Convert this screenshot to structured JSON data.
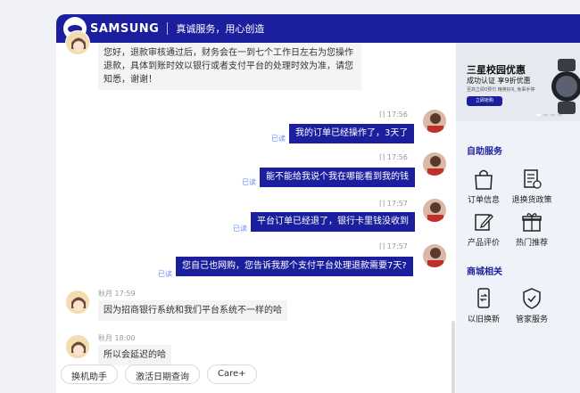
{
  "header": {
    "brand": "SAMSUNG",
    "slogan": "真诚服务，用心创造"
  },
  "messages": [
    {
      "from": "agent",
      "text": "您好，退款审核通过后，财务会在一到七个工作日左右为您操作退款，具体到账时效以银行或者支付平台的处理时效为准，请您知悉，谢谢！"
    },
    {
      "from": "user",
      "time": "17:56",
      "read": "已读",
      "text": "我的订单已经操作了，3天了"
    },
    {
      "from": "user",
      "time": "17:56",
      "read": "已读",
      "text": "能不能给我说个我在哪能看到我的钱"
    },
    {
      "from": "user",
      "time": "17:57",
      "read": "已读",
      "text": "平台订单已经退了，银行卡里钱没收到"
    },
    {
      "from": "user",
      "time": "17:57",
      "read": "已读",
      "text": "您自己也网购，您告诉我那个支付平台处理退款需要7天?"
    },
    {
      "from": "agent",
      "name_time": "秋月 17:59",
      "text": "因为招商银行系统和我们平台系统不一样的哈"
    },
    {
      "from": "agent",
      "name_time": "秋月 18:00",
      "text": "所以会延迟的哈"
    }
  ],
  "quick_replies": [
    "换机助手",
    "激活日期查询",
    "Care+"
  ],
  "sidebar": {
    "banner": {
      "title": "三星校园优惠",
      "subtitle": "成功认证 享9折优惠",
      "tiny": "至高立即0预付 精英好礼 免事手停",
      "button": "立即抢购"
    },
    "self_service": {
      "title": "自助服务",
      "items": [
        "订单信息",
        "退换货政策",
        "产品评价",
        "热门推荐"
      ]
    },
    "mall": {
      "title": "商城相关",
      "items": [
        "以旧换新",
        "管家服务"
      ]
    }
  },
  "colors": {
    "brand_blue": "#1c1f9d",
    "read_blue": "#6c8cf5"
  }
}
